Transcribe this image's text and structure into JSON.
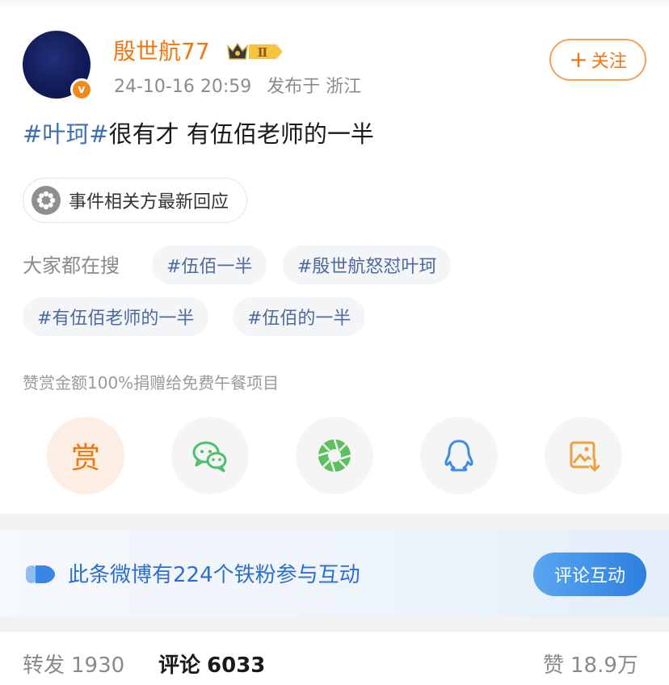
{
  "post": {
    "username": "殷世航77",
    "member_level": "Ⅱ",
    "verified_mark": "v",
    "timestamp": "24-10-16 20:59",
    "publish_region": "发布于 浙江",
    "follow_label": "关注",
    "text_tag": "#叶珂#",
    "text_body": "很有才 有伍佰老师的一半"
  },
  "event_chip": {
    "label": "事件相关方最新回应"
  },
  "search": {
    "label": "大家都在搜",
    "chips": [
      "#伍佰一半",
      "#殷世航怒怼叶珂",
      "#有伍佰老师的一半",
      "#伍佰的一半"
    ]
  },
  "reward": {
    "note": "赞赏金额100%捐赠给免费午餐项目",
    "button_label": "赏"
  },
  "share_icons": [
    "reward-icon",
    "wechat-icon",
    "moments-icon",
    "qq-icon",
    "save-image-icon"
  ],
  "fans_interaction": {
    "text": "此条微博有224个铁粉参与互动",
    "button_label": "评论互动"
  },
  "stats": {
    "repost_label": "转发",
    "repost_count": "1930",
    "comment_label": "评论",
    "comment_count": "6033",
    "like_label": "赞",
    "like_count": "18.9万"
  },
  "colors": {
    "brand_orange": "#f0760f",
    "link_blue": "#3f6fb4",
    "interaction_blue": "#2c6fd0"
  }
}
